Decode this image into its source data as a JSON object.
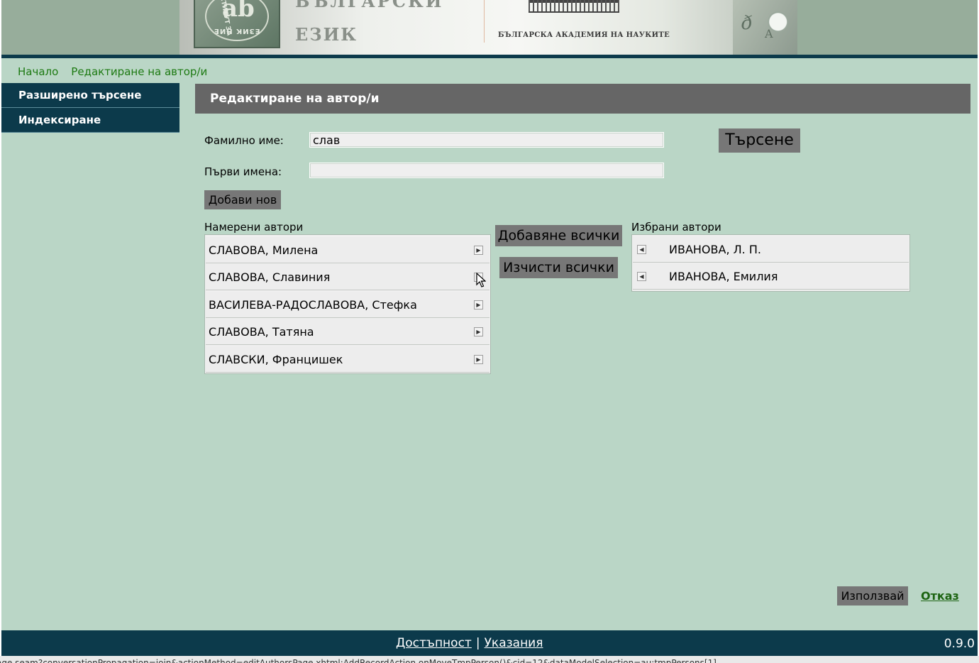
{
  "banner": {
    "title_top": "БЪЛГАРСКИ",
    "title_main": "ЕЗИК",
    "logo_letters": "ab",
    "logo_arc": "ИНСТИТУТ ЗА",
    "logo_arc_bottom": "ЕЗИК НИЕ",
    "academy": "БЪЛГАРСКА АКАДЕМИЯ НА НАУКИТЕ",
    "deco_letter": "ð",
    "deco_letter2": "A"
  },
  "breadcrumb": {
    "home": "Начало",
    "current": "Редактиране на автор/и"
  },
  "sidebar": {
    "items": [
      {
        "label": "Разширено търсене"
      },
      {
        "label": "Индексиране"
      }
    ]
  },
  "panel": {
    "title": "Редактиране на автор/и"
  },
  "form": {
    "surname_label": "Фамилно име:",
    "surname_value": "слав",
    "first_names_label": "Първи имена:",
    "first_names_value": "",
    "search_button": "Търсене",
    "add_new_button": "Добави нов"
  },
  "found_authors": {
    "title": "Намерени автори",
    "items": [
      "СЛАВОВА, Милена",
      "СЛАВОВА, Славиния",
      "ВАСИЛЕВА-РАДОСЛАВОВА, Стефка",
      "СЛАВОВА, Татяна",
      "СЛАВСКИ, Францишек"
    ],
    "arrow": "▶"
  },
  "transfer": {
    "add_all": "Добавяне всички",
    "clear_all": "Изчисти всички"
  },
  "selected_authors": {
    "title": "Избрани автори",
    "items": [
      "ИВАНОВА, Л. П.",
      "ИВАНОВА, Емилия"
    ],
    "arrow": "◀"
  },
  "actions": {
    "use": "Използвай",
    "cancel": "Отказ"
  },
  "footer": {
    "accessibility": "Достъпност",
    "separator": "|",
    "instructions": "Указания",
    "version": "0.9.0"
  },
  "statusbar": {
    "text": "orPage.seam?conversationPropagation=join&actionMethod=editAuthorsPage.xhtml:AddRecordAction.onMoveTmpPerson()&cid=12&dataModelSelection=au:tmpPersons[1]"
  }
}
